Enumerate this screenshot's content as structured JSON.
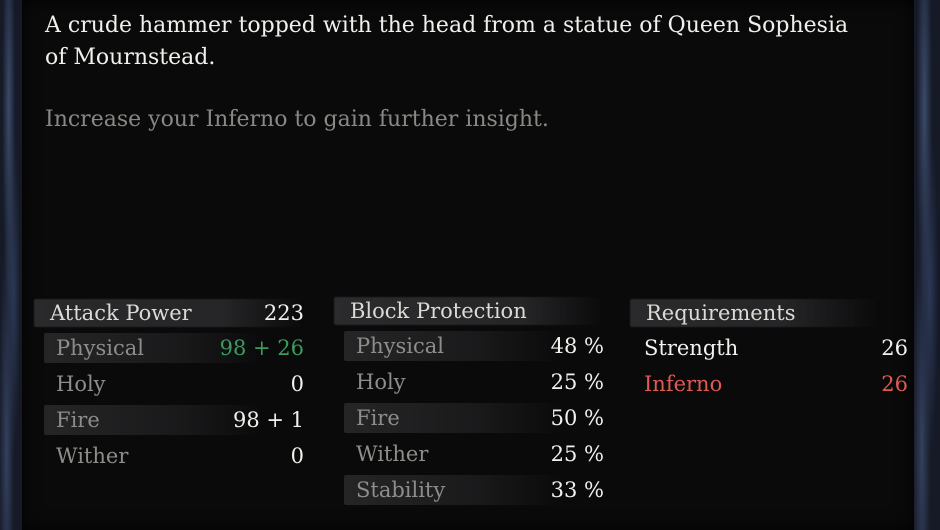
{
  "item": {
    "description": "A crude hammer topped with the head from a statue of Queen Sophesia of Mournstead.",
    "hint": "Increase your Inferno to gain further insight."
  },
  "attack": {
    "title": "Attack Power",
    "total": "223",
    "rows": [
      {
        "label": "Physical",
        "value": "98 + 26",
        "shaded": true,
        "color": "#3d9a5e"
      },
      {
        "label": "Holy",
        "value": "0",
        "shaded": false
      },
      {
        "label": "Fire",
        "value": "98 + 1",
        "shaded": true
      },
      {
        "label": "Wither",
        "value": "0",
        "shaded": false
      }
    ]
  },
  "block": {
    "title": "Block Protection",
    "rows": [
      {
        "label": "Physical",
        "value": "48 %",
        "shaded": true
      },
      {
        "label": "Holy",
        "value": "25 %",
        "shaded": false
      },
      {
        "label": "Fire",
        "value": "50 %",
        "shaded": true
      },
      {
        "label": "Wither",
        "value": "25 %",
        "shaded": false
      },
      {
        "label": "Stability",
        "value": "33 %",
        "shaded": true
      }
    ]
  },
  "requirements": {
    "title": "Requirements",
    "rows": [
      {
        "label": "Strength",
        "value": "26",
        "unmet": false
      },
      {
        "label": "Inferno",
        "value": "26",
        "unmet": true,
        "color": "#e05a55"
      }
    ]
  }
}
